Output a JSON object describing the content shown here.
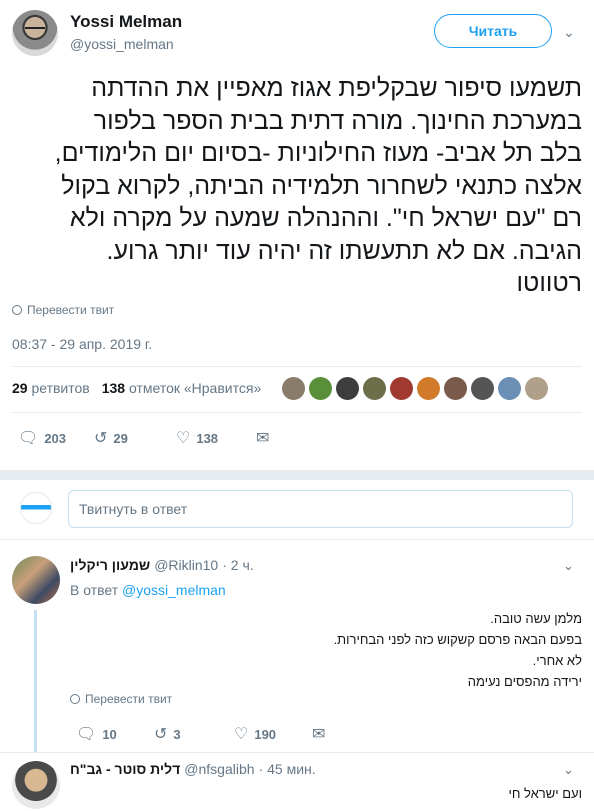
{
  "author": {
    "name": "Yossi Melman",
    "handle": "@yossi_melman",
    "follow_label": "Читать"
  },
  "tweet": {
    "lines": [
      "תשמעו סיפור שבקליפת אגוז מאפיין את ההדתה",
      "במערכת החינוך. מורה דתית בבית הספר בלפור",
      "בלב תל אביב- מעוז החילוניות -בסיום יום הלימודים,",
      "אלצה כתנאי לשחרור תלמידיה הביתה, לקרוא בקול",
      "רם \"עם ישראל חי\". וההנהלה שמעה על מקרה ולא",
      "הגיבה. אם לא תתעשתו זה יהיה עוד יותר גרוע.",
      "רטווטו"
    ],
    "translate_label": "Перевести твит",
    "timestamp": "08:37 - 29 апр. 2019 г."
  },
  "stats": {
    "retweets_count": "29",
    "retweets_label": "ретвитов",
    "likes_count": "138",
    "likes_label": "отметок «Нравится»"
  },
  "likers_colors": [
    "#8a7c6a",
    "#5a8f3a",
    "#3d3d3d",
    "#6c6f4a",
    "#a0392f",
    "#d07a2a",
    "#7a5a4a",
    "#555555",
    "#6b8fb5",
    "#b0a08a"
  ],
  "actions": {
    "replies": "203",
    "retweets": "29",
    "likes": "138"
  },
  "reply_box": {
    "placeholder": "Твитнуть в ответ"
  },
  "replies": [
    {
      "name": "שמעון ריקלין",
      "handle": "@Riklin10",
      "time": "· 2 ч.",
      "in_reply_prefix": "В ответ",
      "in_reply_handle": "@yossi_melman",
      "lines": [
        "מלמן עשה טובה.",
        "בפעם הבאה פרסם קשקוש כזה לפני הבחירות.",
        "לא אחרי.",
        "ירידה מהפסים נעימה"
      ],
      "translate_label": "Перевести твит",
      "replies": "10",
      "retweets": "3",
      "likes": "190"
    },
    {
      "name": "דלית סוטר - גב\"ח",
      "handle": "@nfsgalibh",
      "time": "· 45 мин.",
      "lines": [
        "ועם ישראל חי"
      ]
    }
  ]
}
